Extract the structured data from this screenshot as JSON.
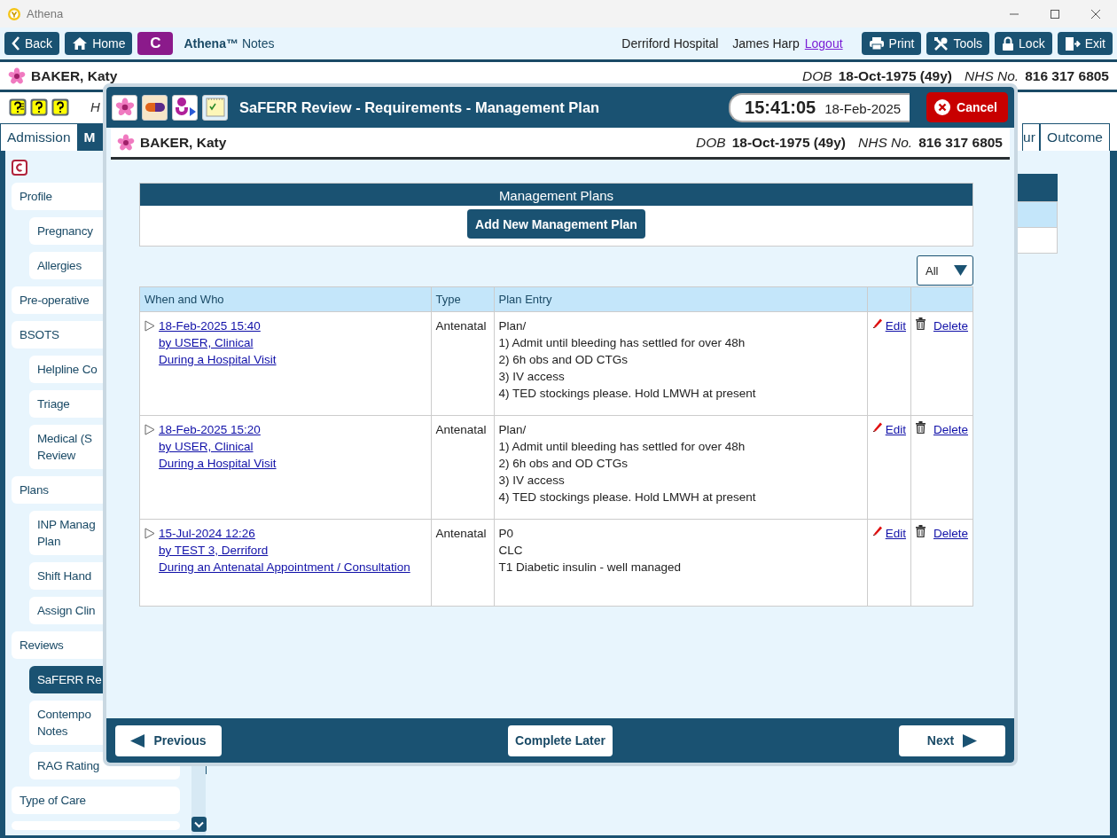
{
  "window": {
    "title": "Athena"
  },
  "toolbar": {
    "left_buttons": [
      {
        "label": "Back",
        "kind": "back"
      },
      {
        "label": "Home",
        "kind": "home"
      },
      {
        "label": "C",
        "kind": "badge"
      }
    ],
    "product": {
      "name": "Athena™",
      "suffix": "Notes"
    },
    "hospital": "Derriford Hospital",
    "user": "James Harp",
    "logout": "Logout",
    "right_buttons": [
      {
        "label": "Print",
        "kind": "print"
      },
      {
        "label": "Tools",
        "kind": "tools"
      },
      {
        "label": "Lock",
        "kind": "lock"
      },
      {
        "label": "Exit",
        "kind": "exit"
      }
    ]
  },
  "patient": {
    "name": "BAKER, Katy",
    "dob_label": "DOB",
    "dob": "18-Oct-1975 (49y)",
    "nhs_label": "NHS No.",
    "nhs": "816 317 6805"
  },
  "subheader": {
    "text": "H"
  },
  "tabs": [
    {
      "label": "Admission",
      "selected": false
    },
    {
      "label": "M",
      "selected": true
    },
    {
      "label": "ur",
      "selected": false
    },
    {
      "label": "Outcome",
      "selected": false
    }
  ],
  "sidebar": {
    "items": [
      {
        "label": "Profile",
        "selected": false,
        "children": [
          {
            "label": "Pregnancy",
            "selected": false
          },
          {
            "label": "Allergies",
            "selected": false
          }
        ]
      },
      {
        "label": "Pre-operative",
        "selected": false
      },
      {
        "label": "BSOTS",
        "selected": false,
        "children": [
          {
            "label": "Helpline Co",
            "selected": false
          },
          {
            "label": "Triage",
            "selected": false
          },
          {
            "label": "Medical (S\nReview",
            "selected": false
          }
        ]
      },
      {
        "label": "Plans",
        "selected": false,
        "children": [
          {
            "label": "INP Manag\nPlan",
            "selected": false
          },
          {
            "label": "Shift Hand",
            "selected": false
          },
          {
            "label": "Assign Clin",
            "selected": false
          }
        ]
      },
      {
        "label": "Reviews",
        "selected": false,
        "children": [
          {
            "label": "SaFERR Re",
            "selected": true
          },
          {
            "label": "Contempo\nNotes",
            "selected": false
          },
          {
            "label": "RAG Rating",
            "selected": false
          }
        ]
      },
      {
        "label": "Type of Care",
        "selected": false
      }
    ]
  },
  "dialog": {
    "title": "SaFERR Review - Requirements - Management Plan",
    "time": "15:41:05",
    "date": "18-Feb-2025",
    "cancel": "Cancel",
    "patient": {
      "name": "BAKER, Katy",
      "dob_label": "DOB",
      "dob": "18-Oct-1975 (49y)",
      "nhs_label": "NHS No.",
      "nhs": "816 317 6805"
    },
    "plans": {
      "title": "Management Plans",
      "add_button": "Add New Management Plan"
    },
    "filter": {
      "value": "All"
    },
    "table": {
      "columns": [
        "When and Who",
        "Type",
        "Plan Entry"
      ],
      "rows": [
        {
          "expanded": false,
          "when": "18-Feb-2025 15:40",
          "who": "by USER, Clinical",
          "context": "During a Hospital Visit",
          "type": "Antenatal",
          "entry": [
            "Plan/",
            "1) Admit until bleeding has settled for over 48h",
            "2) 6h obs and OD CTGs",
            "3) IV access",
            "4) TED stockings please. Hold LMWH at present"
          ],
          "edit": "Edit",
          "delete": "Delete"
        },
        {
          "expanded": false,
          "when": "18-Feb-2025 15:20",
          "who": "by USER, Clinical",
          "context": "During a Hospital Visit",
          "type": "Antenatal",
          "entry": [
            "Plan/",
            "1) Admit until bleeding has settled for over 48h",
            "2) 6h obs and OD CTGs",
            "3) IV access",
            "4) TED stockings please. Hold LMWH at present"
          ],
          "edit": "Edit",
          "delete": "Delete"
        },
        {
          "expanded": false,
          "when": "15-Jul-2024 12:26",
          "who": "by TEST 3, Derriford",
          "context": "During an Antenatal Appointment / Consultation",
          "type": "Antenatal",
          "entry": [
            "P0",
            "CLC",
            "T1 Diabetic insulin - well managed"
          ],
          "edit": "Edit",
          "delete": "Delete"
        }
      ]
    },
    "footer": {
      "previous": "Previous",
      "complete_later": "Complete Later",
      "next": "Next"
    }
  }
}
